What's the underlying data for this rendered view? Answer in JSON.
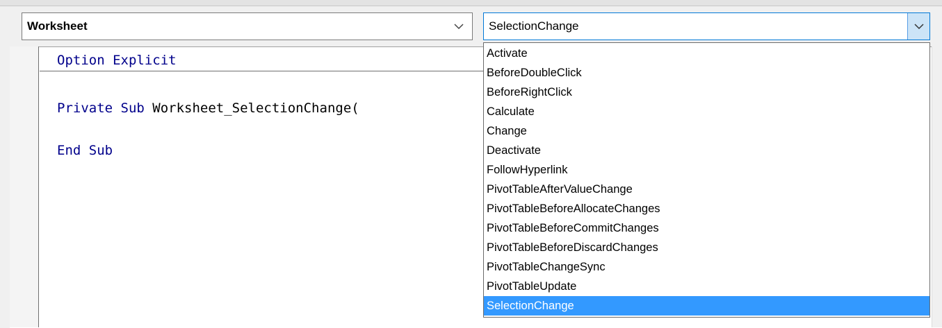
{
  "object_combo": {
    "value": "Worksheet"
  },
  "procedure_combo": {
    "value": "SelectionChange"
  },
  "code": {
    "line1_kw": "Option Explicit",
    "line2_kw1": "Private Sub",
    "line2_rest": " Worksheet_SelectionChange(",
    "line3_kw": "End Sub"
  },
  "dropdown": {
    "items": [
      "Activate",
      "BeforeDoubleClick",
      "BeforeRightClick",
      "Calculate",
      "Change",
      "Deactivate",
      "FollowHyperlink",
      "PivotTableAfterValueChange",
      "PivotTableBeforeAllocateChanges",
      "PivotTableBeforeCommitChanges",
      "PivotTableBeforeDiscardChanges",
      "PivotTableChangeSync",
      "PivotTableUpdate",
      "SelectionChange"
    ],
    "selected_index": 13
  },
  "colors": {
    "keyword": "#00008b",
    "selection": "#3399ff",
    "combo_focus_border": "#0078d7"
  }
}
